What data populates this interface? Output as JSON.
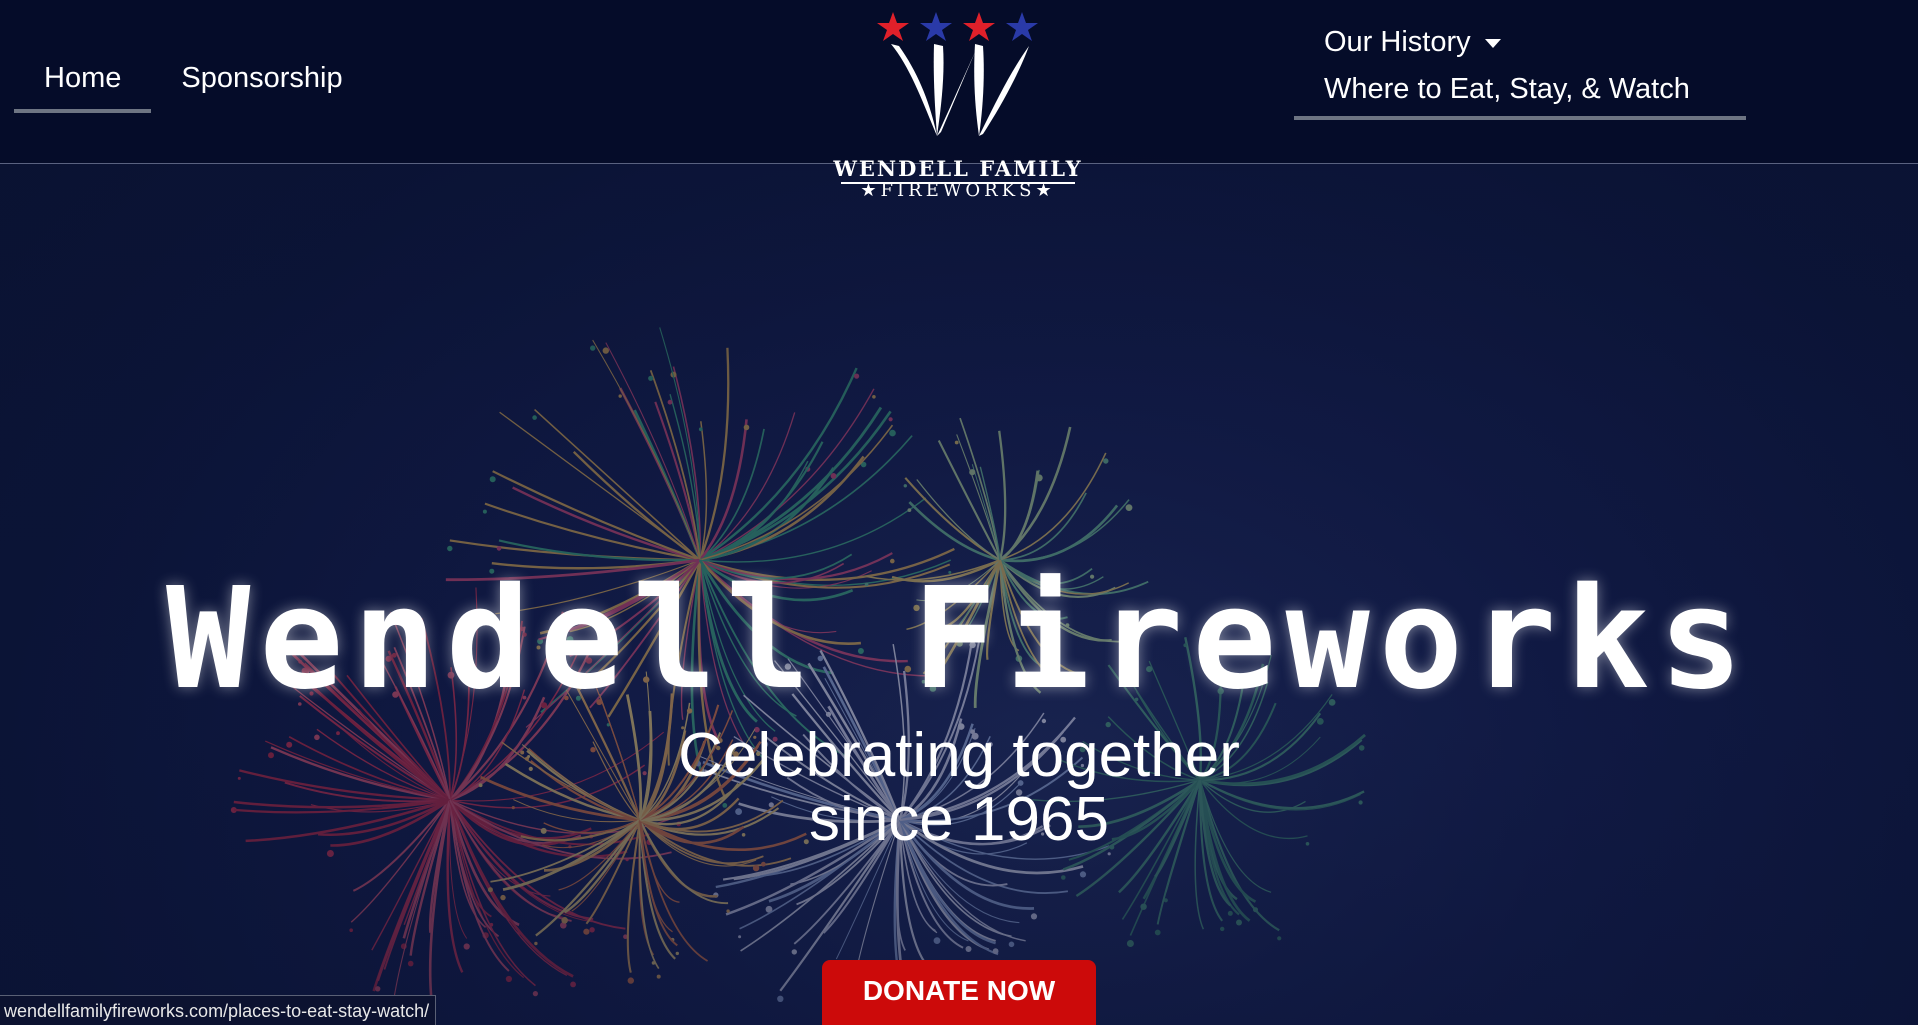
{
  "nav": {
    "left": [
      {
        "label": "Home",
        "active": true
      },
      {
        "label": "Sponsorship",
        "active": false
      }
    ],
    "right": [
      {
        "label": "Our History",
        "dropdown": true,
        "active": false
      },
      {
        "label": "Where to Eat, Stay, & Watch",
        "active": true
      }
    ]
  },
  "logo": {
    "line1": "Wendell Family",
    "line2": "★FIREWORKS★",
    "star_colors": [
      "#e0202a",
      "#2a3aa8",
      "#e0202a",
      "#2a3aa8"
    ]
  },
  "hero": {
    "title": "Wendell Fireworks",
    "subtitle_line1": "Celebrating together",
    "subtitle_line2": "since 1965"
  },
  "donate_label": "DONATE NOW",
  "status_url": "wendellfamilyfireworks.com/places-to-eat-stay-watch/",
  "colors": {
    "donate": "#cc0a0a",
    "header_bg": "#050c28",
    "active_underline": "#6e7583"
  }
}
